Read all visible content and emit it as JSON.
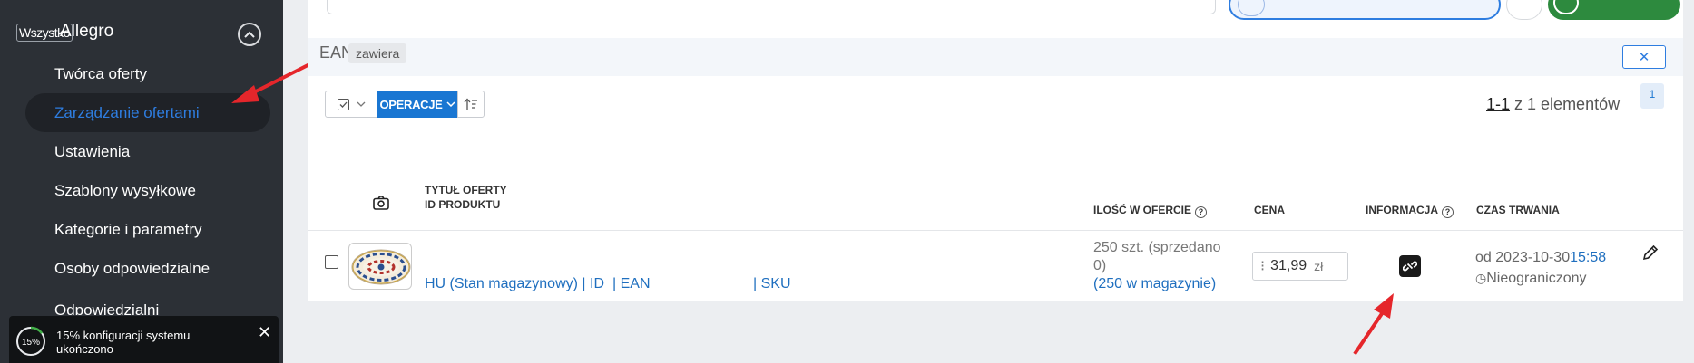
{
  "sidebar": {
    "wszystko": "Wszystko",
    "app_title": "Allegro",
    "items": [
      {
        "label": "Twórca oferty"
      },
      {
        "label": "Zarządzanie ofertami"
      },
      {
        "label": "Ustawienia"
      },
      {
        "label": "Szablony wysyłkowe"
      },
      {
        "label": "Kategorie i parametry"
      },
      {
        "label": "Osoby odpowiedzialne"
      },
      {
        "label": "Odpowiedzialni"
      }
    ],
    "active_index": 1,
    "toast": {
      "progress_text": "15%",
      "progress": 0.15,
      "text": "15% konfiguracji systemu ukończono"
    }
  },
  "filter": {
    "field": "EAN",
    "operator": "zawiera"
  },
  "toolbar": {
    "operations_label": "OPERACJE"
  },
  "pagination": {
    "range": "1-1",
    "of_text": "z 1 elementów",
    "current_page": "1"
  },
  "table": {
    "headers": {
      "title": "TYTUŁ OFERTY",
      "product_id": "ID PRODUKTU",
      "quantity": "ILOŚĆ W OFERCIE",
      "price": "CENA",
      "information": "INFORMACJA",
      "duration": "CZAS TRWANIA"
    },
    "row": {
      "ident_part1": "HU (Stan magazynowy) | ID",
      "ident_part2": "| EAN",
      "ident_part3": "| SKU",
      "qty_line1": "250 szt. (sprzedano",
      "qty_line2": "0)",
      "qty_line3": "(250 w magazynie)",
      "price_value": "31,99",
      "price_currency": "zł",
      "duration_date": "od 2023-10-30",
      "duration_time": "15:58",
      "duration_unlimited": "Nieograniczony"
    }
  },
  "colors": {
    "accent": "#1976d2",
    "sidebar_bg": "#2c3036",
    "annotation_arrow": "#e5262b",
    "link": "#1f6fbf"
  }
}
